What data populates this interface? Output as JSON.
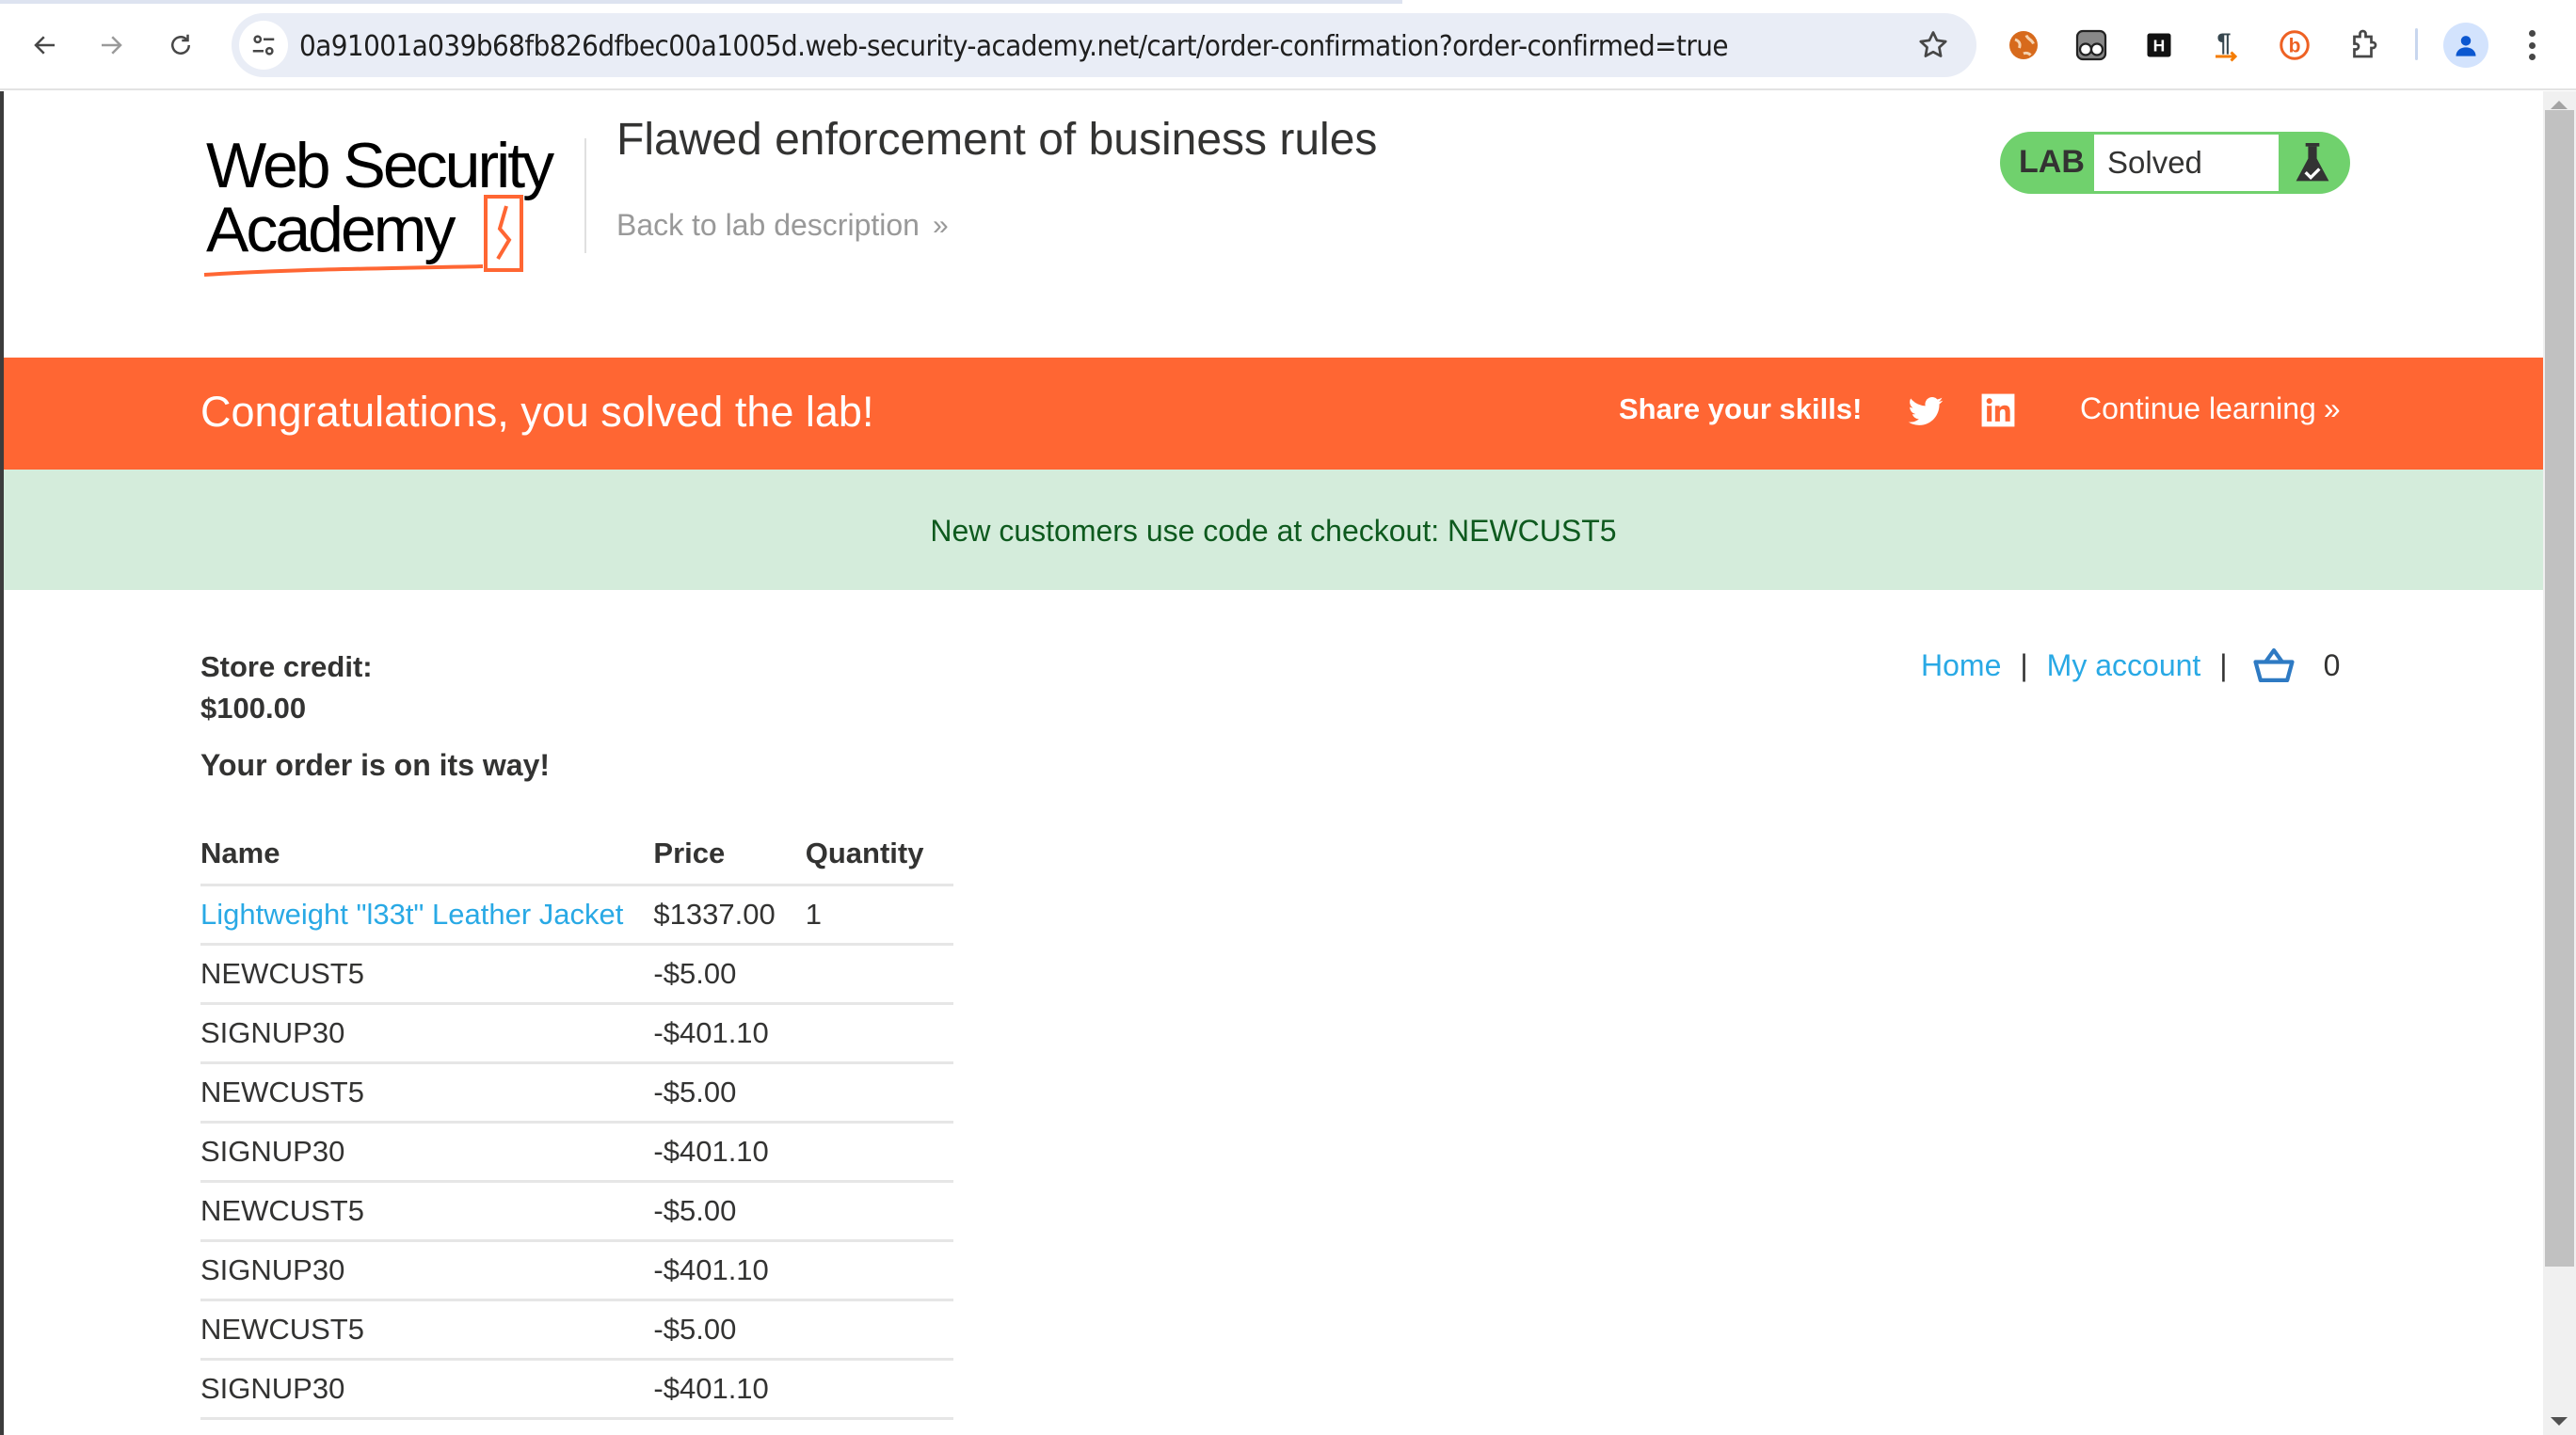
{
  "browser": {
    "url": "0a91001a039b68fb826dfbec00a1005d.web-security-academy.net/cart/order-confirmation?order-confirmed=true",
    "nav": {
      "back": "back-arrow-icon",
      "forward": "forward-arrow-icon",
      "reload": "reload-icon"
    },
    "extensions": [
      "globe-extension-icon",
      "owl-glasses-extension-icon",
      "h-extension-icon",
      "pilcrow-arrow-extension-icon",
      "bitly-extension-icon",
      "puzzle-extensions-icon"
    ]
  },
  "header": {
    "logo_line1": "Web Security",
    "logo_line2": "Academy",
    "lab_title": "Flawed enforcement of business rules",
    "back_link": "Back to lab description",
    "back_chevron": "»",
    "lab_badge": {
      "label": "LAB",
      "status": "Solved"
    }
  },
  "banner": {
    "congrats": "Congratulations, you solved the lab!",
    "share": "Share your skills!",
    "continue": "Continue learning",
    "continue_chevron": "»",
    "color": "#ff6633"
  },
  "notice": {
    "text": "New customers use code at checkout: NEWCUST5"
  },
  "account": {
    "store_credit_label": "Store credit:",
    "store_credit_value": "$100.00",
    "order_message": "Your order is on its way!"
  },
  "top_links": {
    "home": "Home",
    "separator": "|",
    "my_account": "My account",
    "cart_count": "0"
  },
  "order_table": {
    "headers": [
      "Name",
      "Price",
      "Quantity"
    ],
    "rows": [
      {
        "name": "Lightweight \"l33t\" Leather Jacket",
        "price": "$1337.00",
        "quantity": "1",
        "link": true
      },
      {
        "name": "NEWCUST5",
        "price": "-$5.00",
        "quantity": ""
      },
      {
        "name": "SIGNUP30",
        "price": "-$401.10",
        "quantity": ""
      },
      {
        "name": "NEWCUST5",
        "price": "-$5.00",
        "quantity": ""
      },
      {
        "name": "SIGNUP30",
        "price": "-$401.10",
        "quantity": ""
      },
      {
        "name": "NEWCUST5",
        "price": "-$5.00",
        "quantity": ""
      },
      {
        "name": "SIGNUP30",
        "price": "-$401.10",
        "quantity": ""
      },
      {
        "name": "NEWCUST5",
        "price": "-$5.00",
        "quantity": ""
      },
      {
        "name": "SIGNUP30",
        "price": "-$401.10",
        "quantity": ""
      }
    ]
  }
}
